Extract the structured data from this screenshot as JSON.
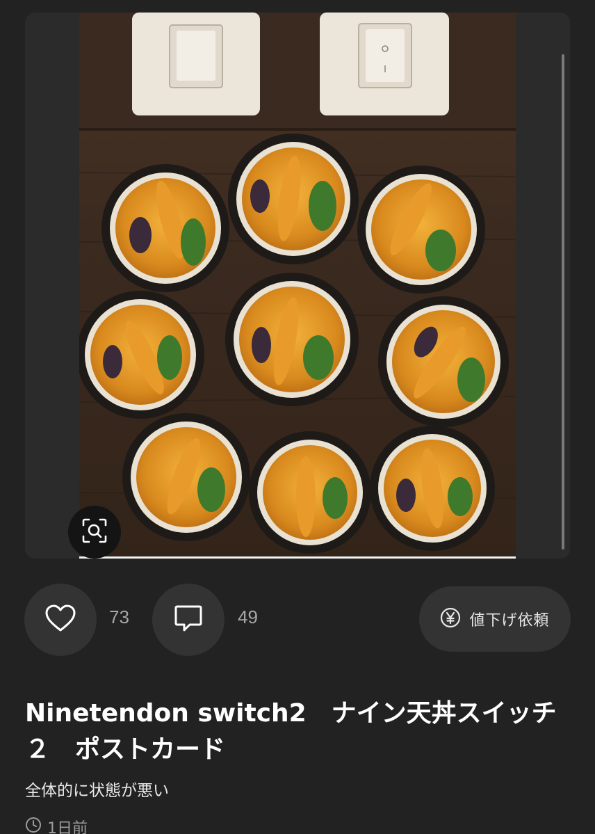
{
  "listing": {
    "title": "Ninetendon switch2　ナイン天丼スイッチ２　ポストカード",
    "condition": "全体的に状態が悪い",
    "posted_ago": "1日前"
  },
  "actions": {
    "like_count": "73",
    "comment_count": "49",
    "price_request_label": "値下げ依頼"
  },
  "icons": {
    "lens": "image-search-icon",
    "like": "heart-icon",
    "comment": "speech-bubble-icon",
    "price": "yen-icon",
    "time": "clock-icon"
  },
  "colors": {
    "background": "#222222",
    "button": "#333333",
    "muted_text": "#a7a7a7"
  }
}
